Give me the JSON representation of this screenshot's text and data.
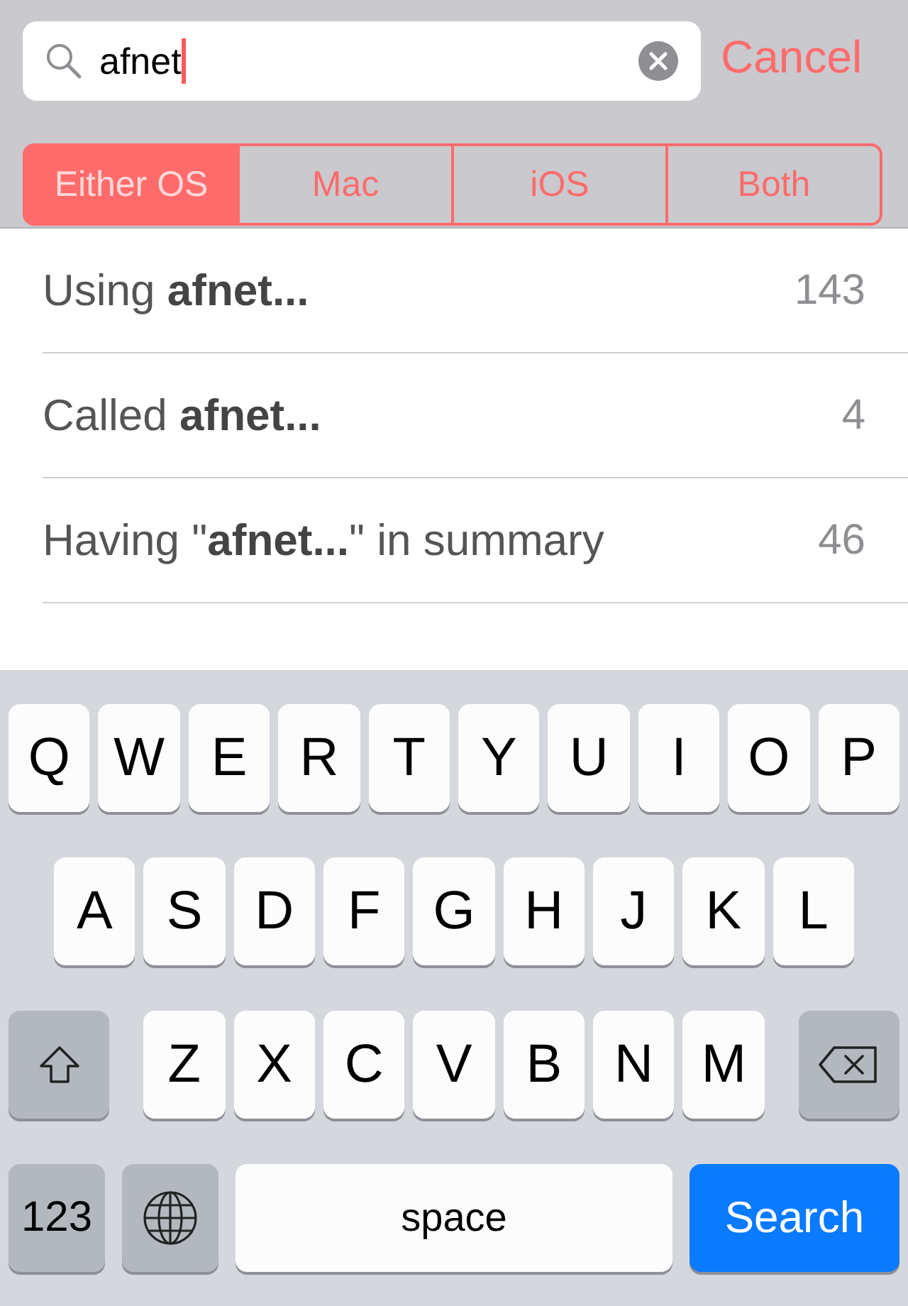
{
  "search": {
    "value": "afnet"
  },
  "cancel": "Cancel",
  "segments": [
    {
      "label": "Either OS",
      "selected": true
    },
    {
      "label": "Mac",
      "selected": false
    },
    {
      "label": "iOS",
      "selected": false
    },
    {
      "label": "Both",
      "selected": false
    }
  ],
  "results": [
    {
      "text": "Using **afnet...**",
      "count": "143"
    },
    {
      "text": "Called **afnet...**",
      "count": "4"
    },
    {
      "text": "Having \"**afnet...**\" in summary",
      "count": "46"
    }
  ],
  "keyboard": [
    [
      {
        "kind": "letter",
        "label": "Q"
      },
      {
        "kind": "letter",
        "label": "W"
      },
      {
        "kind": "letter",
        "label": "E"
      },
      {
        "kind": "letter",
        "label": "R"
      },
      {
        "kind": "letter",
        "label": "T"
      },
      {
        "kind": "letter",
        "label": "Y"
      },
      {
        "kind": "letter",
        "label": "U"
      },
      {
        "kind": "letter",
        "label": "I"
      },
      {
        "kind": "letter",
        "label": "O"
      },
      {
        "kind": "letter",
        "label": "P"
      }
    ],
    [
      {
        "kind": "letter",
        "label": "A"
      },
      {
        "kind": "letter",
        "label": "S"
      },
      {
        "kind": "letter",
        "label": "D"
      },
      {
        "kind": "letter",
        "label": "F"
      },
      {
        "kind": "letter",
        "label": "G"
      },
      {
        "kind": "letter",
        "label": "H"
      },
      {
        "kind": "letter",
        "label": "J"
      },
      {
        "kind": "letter",
        "label": "K"
      },
      {
        "kind": "letter",
        "label": "L"
      }
    ],
    [
      {
        "kind": "shift"
      },
      {
        "kind": "letter",
        "label": "Z"
      },
      {
        "kind": "letter",
        "label": "X"
      },
      {
        "kind": "letter",
        "label": "C"
      },
      {
        "kind": "letter",
        "label": "V"
      },
      {
        "kind": "letter",
        "label": "B"
      },
      {
        "kind": "letter",
        "label": "N"
      },
      {
        "kind": "letter",
        "label": "M"
      },
      {
        "kind": "backspace"
      }
    ],
    [
      {
        "kind": "numbers",
        "label": "123"
      },
      {
        "kind": "globe"
      },
      {
        "kind": "space",
        "label": "space"
      },
      {
        "kind": "search",
        "label": "Search"
      }
    ]
  ]
}
